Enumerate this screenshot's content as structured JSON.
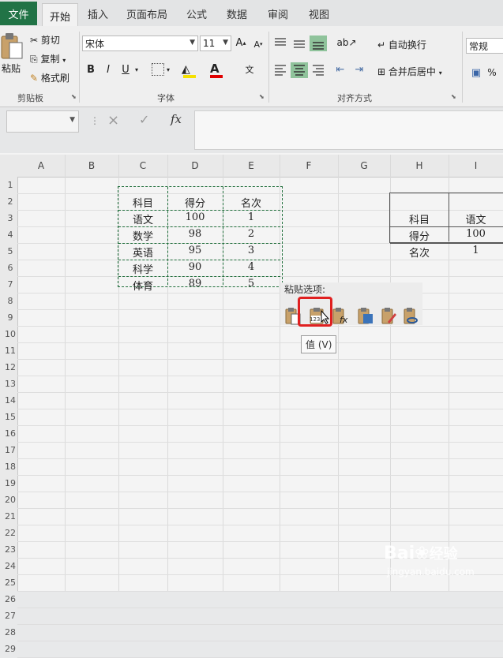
{
  "tabs": [
    "文件",
    "开始",
    "插入",
    "页面布局",
    "公式",
    "数据",
    "审阅",
    "视图"
  ],
  "clipboard": {
    "paste_label": "粘贴",
    "cut_label": "剪切",
    "copy_label": "复制",
    "format_painter_label": "格式刷",
    "group_label": "剪贴板"
  },
  "font": {
    "name": "宋体",
    "size": "11",
    "bold": "B",
    "italic": "I",
    "underline": "U",
    "group_label": "字体"
  },
  "alignment": {
    "wrap_text_label": "自动换行",
    "merge_center_label": "合并后居中",
    "group_label": "对齐方式"
  },
  "number": {
    "format": "常规"
  },
  "formula_bar": {
    "fx": "fx",
    "cancel": "×",
    "enter": "✓"
  },
  "columns": [
    "A",
    "B",
    "C",
    "D",
    "E",
    "F",
    "G",
    "H",
    "I"
  ],
  "rows": [
    "1",
    "2",
    "3",
    "4",
    "5",
    "6",
    "7",
    "8",
    "9",
    "10",
    "11",
    "12",
    "13",
    "14",
    "15",
    "16",
    "17",
    "18",
    "19",
    "20",
    "21",
    "22",
    "23",
    "24",
    "25",
    "26",
    "27",
    "28",
    "29"
  ],
  "table1": {
    "headers": [
      "科目",
      "得分",
      "名次"
    ],
    "rows": [
      [
        "语文",
        "100",
        "1"
      ],
      [
        "数学",
        "98",
        "2"
      ],
      [
        "英语",
        "95",
        "3"
      ],
      [
        "科学",
        "90",
        "4"
      ],
      [
        "体育",
        "89",
        "5"
      ]
    ]
  },
  "table2": {
    "rows": [
      [
        "科目",
        "语文"
      ],
      [
        "得分",
        "100"
      ],
      [
        "名次",
        "1"
      ]
    ]
  },
  "paste_options": {
    "title": "粘贴选项:",
    "tooltip": "值 (V)",
    "values_badge": "123",
    "icons": [
      "paste-icon",
      "paste-values-icon",
      "paste-formulas-icon",
      "paste-transpose-icon",
      "paste-formatting-icon",
      "paste-link-icon"
    ]
  },
  "watermark": {
    "brand": "Bai",
    "brand2": "经验",
    "url": "jingyan.baidu.com"
  },
  "colors": {
    "accent": "#217346",
    "highlight": "#e02020",
    "marquee": "#1e6e3a"
  }
}
